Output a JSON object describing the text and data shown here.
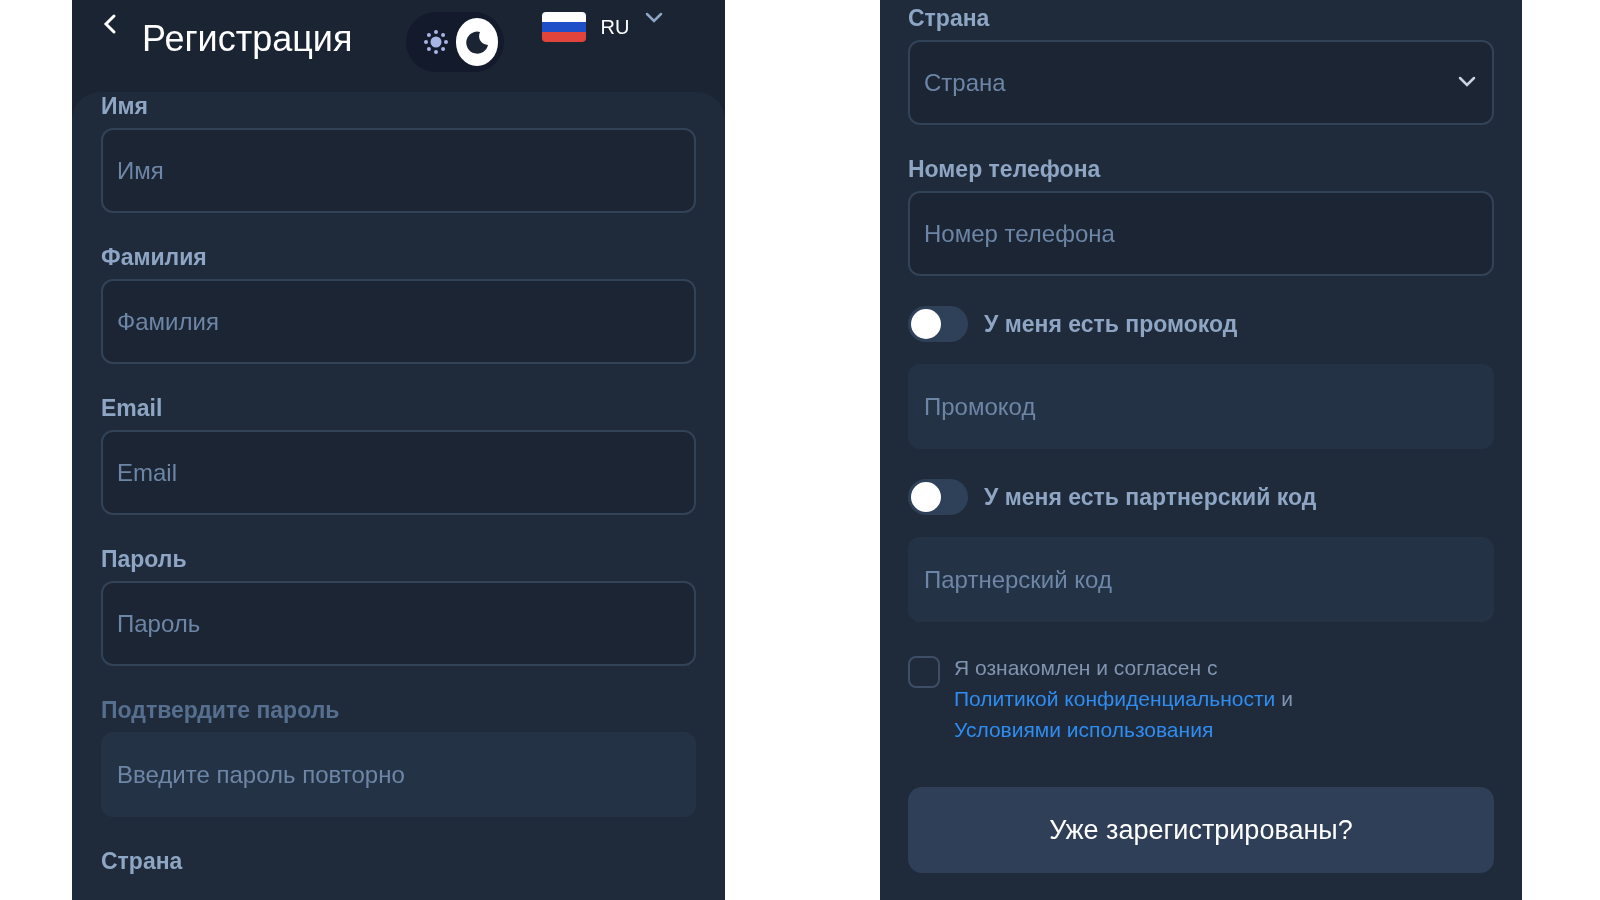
{
  "left_screen": {
    "header": {
      "title": "Регистрация",
      "theme": {
        "dark": true
      },
      "language": {
        "code": "RU"
      }
    },
    "items": [
      {
        "kind": "field",
        "label": "Имя",
        "placeholder": "Имя",
        "disabled": false
      },
      {
        "kind": "field",
        "label": "Фамилия",
        "placeholder": "Фамилия",
        "disabled": false
      },
      {
        "kind": "field",
        "label": "Email",
        "placeholder": "Email",
        "disabled": false
      },
      {
        "kind": "field",
        "label": "Пароль",
        "placeholder": "Пароль",
        "disabled": false
      },
      {
        "kind": "field",
        "label": "Подтвердите пароль",
        "placeholder": "Введите пароль повторно",
        "disabled": true
      },
      {
        "kind": "label",
        "label": "Страна"
      }
    ]
  },
  "right_screen": {
    "items": [
      {
        "kind": "select",
        "label": "Страна",
        "placeholder": "Страна",
        "disabled": false
      },
      {
        "kind": "field",
        "label": "Номер телефона",
        "placeholder": "Номер телефона",
        "disabled": false
      },
      {
        "kind": "toggle",
        "label": "У меня есть промокод",
        "on": false
      },
      {
        "kind": "field",
        "placeholder": "Промокод",
        "disabled": true
      },
      {
        "kind": "toggle",
        "label": "У меня есть партнерский код",
        "on": false
      },
      {
        "kind": "field",
        "placeholder": "Партнерский код",
        "disabled": true
      },
      {
        "kind": "consent",
        "checked": false,
        "text": "Я ознакомлен и согласен с",
        "link_1": "Политикой конфиденциальности",
        "conjunction": "и",
        "link_2": "Условиями использования"
      },
      {
        "kind": "button",
        "text": "Уже зарегистрированы?"
      }
    ]
  }
}
